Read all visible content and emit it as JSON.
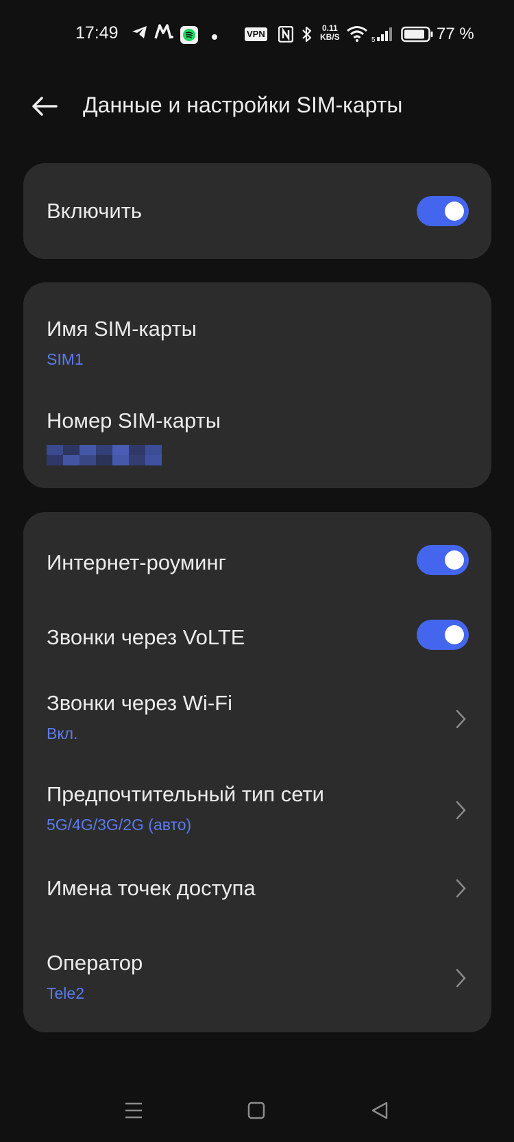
{
  "status_bar": {
    "time": "17:49",
    "vpn": "VPN",
    "speed_value": "0.11",
    "speed_unit": "KB/S",
    "battery": "77 %"
  },
  "header": {
    "title": "Данные и настройки SIM-карты",
    "back_icon": "arrow-left-icon"
  },
  "enable_card": {
    "label": "Включить",
    "enabled": true
  },
  "sim_info": {
    "name_label": "Имя SIM-карты",
    "name_value": "SIM1",
    "number_label": "Номер SIM-карты"
  },
  "settings": {
    "roaming_label": "Интернет-роуминг",
    "roaming_on": true,
    "volte_label": "Звонки через VoLTE",
    "volte_on": true,
    "wifi_calls_label": "Звонки через Wi-Fi",
    "wifi_calls_value": "Вкл.",
    "network_type_label": "Предпочтительный тип сети",
    "network_type_value": "5G/4G/3G/2G (авто)",
    "apn_label": "Имена точек доступа",
    "operator_label": "Оператор",
    "operator_value": "Tele2"
  },
  "colors": {
    "background": "#111111",
    "card": "#2c2c2c",
    "accent": "#4466ee",
    "subtitle": "#5b7bf0"
  }
}
